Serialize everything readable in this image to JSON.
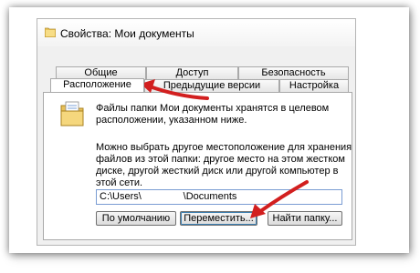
{
  "window": {
    "title": "Свойства: Мои документы"
  },
  "tabs": {
    "row_back": [
      {
        "label": "Общие"
      },
      {
        "label": "Доступ"
      },
      {
        "label": "Безопасность"
      }
    ],
    "row_front": [
      {
        "label": "Расположение",
        "active": true
      },
      {
        "label": "Предыдущие версии"
      },
      {
        "label": "Настройка"
      }
    ]
  },
  "location_tab": {
    "info_line1": "Файлы папки Мои документы хранятся в целевом",
    "info_line2": "расположении, указанном ниже.",
    "desc_line1": "Можно выбрать другое местоположение для хранения",
    "desc_line2": "файлов из этой папки: другое место на этом жестком",
    "desc_line3": "диске, другой жесткий диск или другой компьютер в",
    "desc_line4": "этой сети.",
    "path_value": "C:\\Users\\               \\Documents",
    "buttons": {
      "default": "По умолчанию",
      "move": "Переместить...",
      "find": "Найти папку..."
    }
  },
  "icons": {
    "title_icon": "folder-icon",
    "panel_icon": "documents-folder-icon",
    "annotation": "red-arrow-icon"
  },
  "colors": {
    "annotation_arrow": "#d21f1f",
    "dialog_bg": "#f0f0f0",
    "input_border": "#7a9cd3"
  }
}
